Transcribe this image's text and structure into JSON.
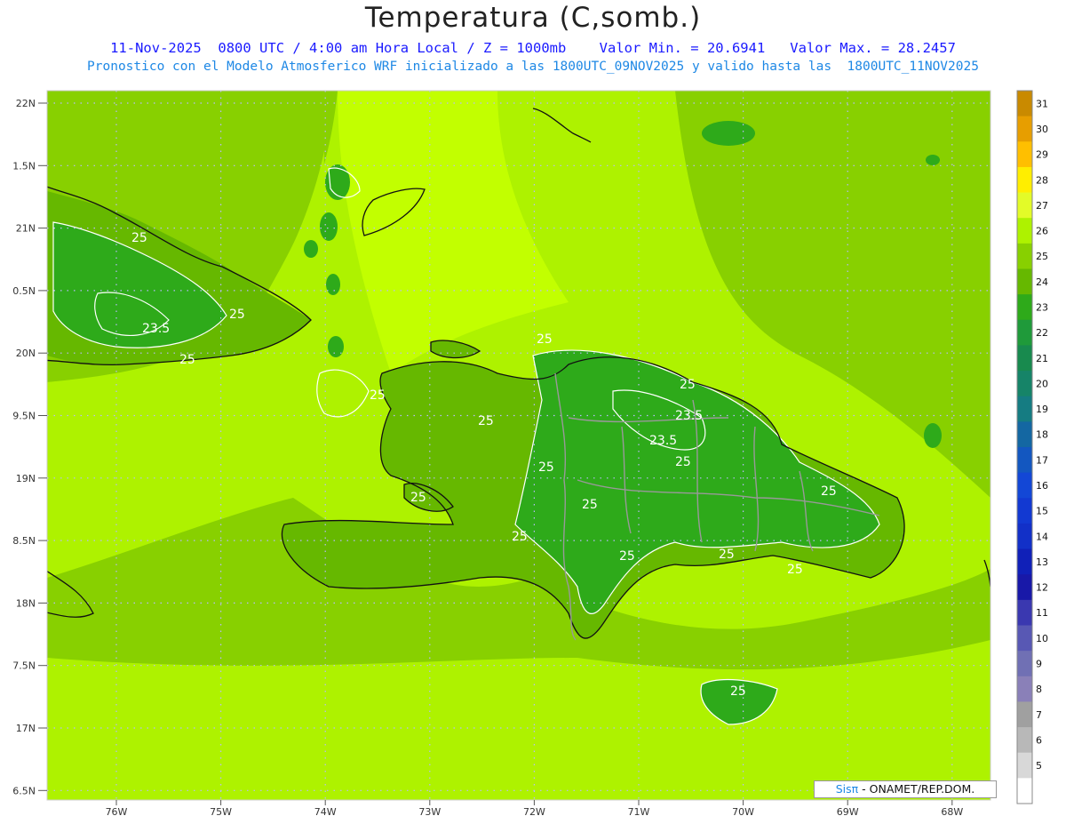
{
  "title": "Temperatura (C,somb.)",
  "subtitle_line1": "11-Nov-2025  0800 UTC / 4:00 am Hora Local / Z = 1000mb    Valor Min. = 20.6941   Valor Max. = 28.2457",
  "subtitle_line2": "Pronostico con el Modelo Atmosferico WRF inicializado a las 1800UTC_09NOV2025 y valido hasta las  1800UTC_11NOV2025",
  "credit": {
    "brand": "Sisπ",
    "text": " - ONAMET/REP.DOM."
  },
  "lat_labels": [
    "22N",
    "1.5N",
    "21N",
    "0.5N",
    "20N",
    "9.5N",
    "19N",
    "8.5N",
    "18N",
    "7.5N",
    "17N",
    "6.5N"
  ],
  "lon_labels": [
    "76W",
    "75W",
    "74W",
    "73W",
    "72W",
    "71W",
    "70W",
    "69W",
    "68W"
  ],
  "contour_labels": [
    "25",
    "23.5",
    "25",
    "25",
    "25",
    "25",
    "25",
    "25",
    "25",
    "23.5",
    "23.5",
    "25",
    "25",
    "25",
    "25",
    "25",
    "25",
    "25",
    "25"
  ],
  "colorbar": {
    "levels": [
      "31",
      "30",
      "29",
      "28",
      "27",
      "26",
      "25",
      "24",
      "23",
      "22",
      "21",
      "20",
      "19",
      "18",
      "17",
      "16",
      "15",
      "14",
      "13",
      "12",
      "11",
      "10",
      "9",
      "8",
      "7",
      "6",
      "5"
    ],
    "colors": [
      "#c98a00",
      "#e79e00",
      "#ffbf00",
      "#ffee00",
      "#e3fb28",
      "#aef200",
      "#88d000",
      "#66b800",
      "#2eaa1a",
      "#1f9a3a",
      "#188a4e",
      "#168468",
      "#157c82",
      "#1467a2",
      "#1357c0",
      "#1347d6",
      "#1239d2",
      "#1230c8",
      "#1020b8",
      "#1818a8",
      "#3a38b0",
      "#5858b4",
      "#7070b4",
      "#8a80b8",
      "#a0a0a0",
      "#b8b8b8",
      "#d8d8d8",
      "#ffffff"
    ]
  },
  "colors": {
    "sea_main": "#aef200",
    "sea_light": "#c2ff00",
    "sea_dark": "#88d000",
    "land_high": "#66b800",
    "land_cool": "#2eaa1a",
    "contour_line": "#ffffff",
    "coast": "#111111",
    "border": "#999999",
    "title": "#222222",
    "subtitle1": "#1a1aff",
    "subtitle2": "#1e88e5"
  }
}
